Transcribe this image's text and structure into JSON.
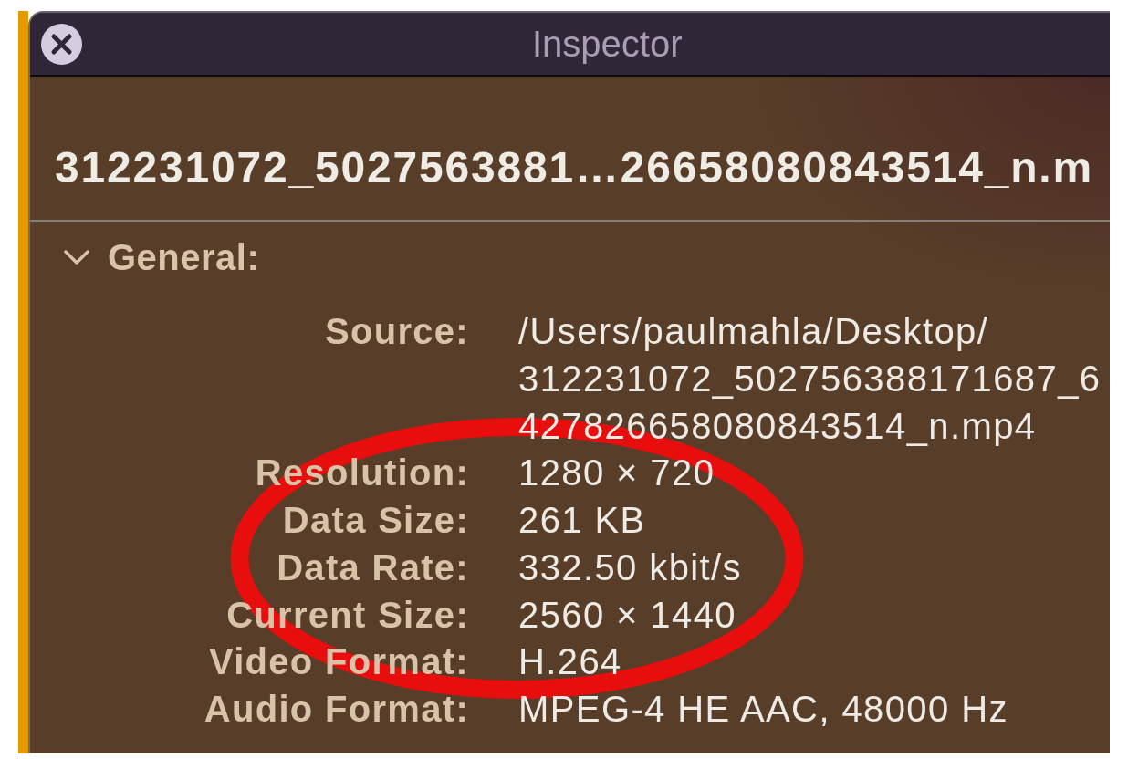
{
  "window": {
    "title": "Inspector"
  },
  "file_name": "312231072_5027563881…26658080843514_n.m",
  "section": {
    "title": "General:",
    "expanded": true,
    "rows": [
      {
        "kind": "path",
        "label": "Source:",
        "value": "/Users/paulmahla/Desktop/312231072_502756388171687_6427826658080843514_n.mp4"
      },
      {
        "kind": "text",
        "label": "Resolution:",
        "value": "1280 × 720"
      },
      {
        "kind": "text",
        "label": "Data Size:",
        "value": "261 KB"
      },
      {
        "kind": "text",
        "label": "Data Rate:",
        "value": "332.50 kbit/s"
      },
      {
        "kind": "text",
        "label": "Current Size:",
        "value": "2560 × 1440"
      },
      {
        "kind": "text",
        "label": "Video Format:",
        "value": "H.264"
      },
      {
        "kind": "text",
        "label": "Audio Format:",
        "value": "MPEG-4 HE AAC, 48000 Hz"
      }
    ]
  },
  "annotations": [
    {
      "kind": "ellipse"
    }
  ]
}
